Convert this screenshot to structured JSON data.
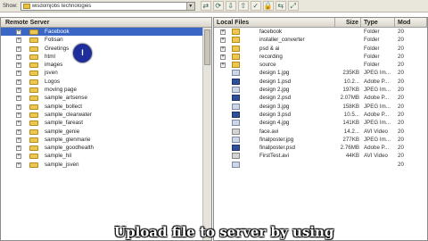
{
  "toolbar": {
    "show_label": "Show:",
    "site_value": "wisdomjobs technologies",
    "icons": [
      "connect-icon",
      "refresh-icon",
      "get-icon",
      "put-icon",
      "checkout-icon",
      "checkin-icon",
      "sync-icon",
      "expand-icon"
    ],
    "glyphs": [
      "⇄",
      "⟳",
      "⇩",
      "⇧",
      "✓",
      "🔒",
      "⇆",
      "⤢"
    ]
  },
  "left_pane": {
    "header": "Remote Server",
    "items": [
      {
        "label": "Facebook"
      },
      {
        "label": "Fotisan"
      },
      {
        "label": "Greetings"
      },
      {
        "label": "html"
      },
      {
        "label": "images"
      },
      {
        "label": "jsven"
      },
      {
        "label": "Logos"
      },
      {
        "label": "moving page"
      },
      {
        "label": "sample_artsense"
      },
      {
        "label": "sample_bollect"
      },
      {
        "label": "sample_clearwater"
      },
      {
        "label": "sample_fareast"
      },
      {
        "label": "sample_genie"
      },
      {
        "label": "sample_glenmarie"
      },
      {
        "label": "sample_goodhealth"
      },
      {
        "label": "sample_hil"
      },
      {
        "label": "sample_jsven"
      }
    ],
    "cursor_glyph": "I"
  },
  "right_pane": {
    "columns": {
      "name": "Local Files",
      "size": "Size",
      "type": "Type",
      "modified": "Mod"
    },
    "rows": [
      {
        "name": "facebook",
        "size": "",
        "type": "Folder",
        "modified": "20",
        "icon": "folder"
      },
      {
        "name": "installer_converter",
        "size": "",
        "type": "Folder",
        "modified": "20",
        "icon": "folder"
      },
      {
        "name": "psd & ai",
        "size": "",
        "type": "Folder",
        "modified": "20",
        "icon": "folder"
      },
      {
        "name": "recording",
        "size": "",
        "type": "Folder",
        "modified": "20",
        "icon": "folder"
      },
      {
        "name": "source",
        "size": "",
        "type": "Folder",
        "modified": "20",
        "icon": "folder"
      },
      {
        "name": "design 1.jpg",
        "size": "235KB",
        "type": "JPEG Im...",
        "modified": "20",
        "icon": "jpg"
      },
      {
        "name": "design 1.psd",
        "size": "10.2...",
        "type": "Adobe P...",
        "modified": "20",
        "icon": "psd"
      },
      {
        "name": "design 2.jpg",
        "size": "197KB",
        "type": "JPEG Im...",
        "modified": "20",
        "icon": "jpg"
      },
      {
        "name": "design 2.psd",
        "size": "2.07MB",
        "type": "Adobe P...",
        "modified": "20",
        "icon": "psd"
      },
      {
        "name": "design 3.jpg",
        "size": "158KB",
        "type": "JPEG Im...",
        "modified": "20",
        "icon": "jpg"
      },
      {
        "name": "design 3.psd",
        "size": "10.5...",
        "type": "Adobe P...",
        "modified": "20",
        "icon": "psd"
      },
      {
        "name": "design 4.jpg",
        "size": "141KB",
        "type": "JPEG Im...",
        "modified": "20",
        "icon": "jpg"
      },
      {
        "name": "face.avi",
        "size": "14.2...",
        "type": "AVI Video",
        "modified": "20",
        "icon": "avi"
      },
      {
        "name": "finalposter.jpg",
        "size": "277KB",
        "type": "JPEG Im...",
        "modified": "20",
        "icon": "jpg"
      },
      {
        "name": "finalposter.psd",
        "size": "2.76MB",
        "type": "Adobe P...",
        "modified": "20",
        "icon": "psd"
      },
      {
        "name": "FirstTest.avi",
        "size": "44KB",
        "type": "AVI Video",
        "modified": "20",
        "icon": "avi"
      },
      {
        "name": "",
        "size": "",
        "type": "",
        "modified": "20",
        "icon": "jpg"
      }
    ]
  },
  "caption": "Upload file to server by using"
}
